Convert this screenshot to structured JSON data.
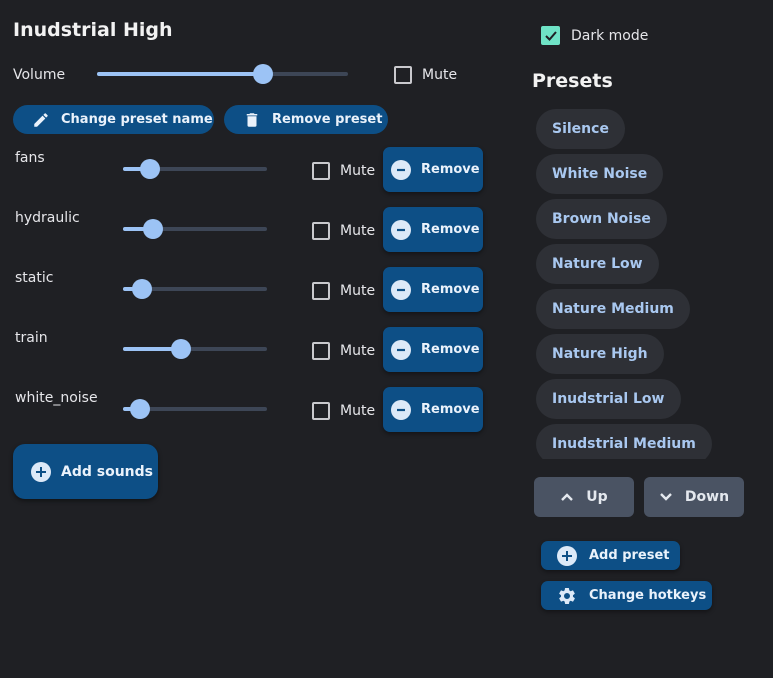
{
  "preset_title": "Inudstrial High",
  "volume": {
    "label": "Volume",
    "value": 0.66,
    "mute_label": "Mute",
    "muted": false
  },
  "actions": {
    "change_name": "Change preset name",
    "remove_preset": "Remove preset",
    "add_sounds": "Add sounds"
  },
  "sounds": [
    {
      "name": "fans",
      "value": 0.19,
      "mute_label": "Mute",
      "muted": false,
      "remove_label": "Remove"
    },
    {
      "name": "hydraulic",
      "value": 0.21,
      "mute_label": "Mute",
      "muted": false,
      "remove_label": "Remove"
    },
    {
      "name": "static",
      "value": 0.13,
      "mute_label": "Mute",
      "muted": false,
      "remove_label": "Remove"
    },
    {
      "name": "train",
      "value": 0.4,
      "mute_label": "Mute",
      "muted": false,
      "remove_label": "Remove"
    },
    {
      "name": "white_noise",
      "value": 0.12,
      "mute_label": "Mute",
      "muted": false,
      "remove_label": "Remove"
    }
  ],
  "dark_mode": {
    "label": "Dark mode",
    "checked": true
  },
  "presets": {
    "title": "Presets",
    "items": [
      "Silence",
      "White Noise",
      "Brown Noise",
      "Nature Low",
      "Nature Medium",
      "Nature High",
      "Inudstrial Low",
      "Inudstrial Medium"
    ]
  },
  "nav": {
    "up": "Up",
    "down": "Down"
  },
  "right_actions": {
    "add_preset": "Add preset",
    "change_hotkeys": "Change hotkeys"
  },
  "colors": {
    "background": "#1f2024",
    "primary": "#0d4f86",
    "accent": "#9cc3f5",
    "check": "#6fe3c6",
    "chip": "#2e3036"
  },
  "icons": {
    "edit": "pencil-icon",
    "delete": "trash-icon",
    "remove": "minus-circle-icon",
    "add": "plus-circle-icon",
    "up": "chevron-up-icon",
    "down": "chevron-down-icon",
    "settings": "gear-icon"
  }
}
